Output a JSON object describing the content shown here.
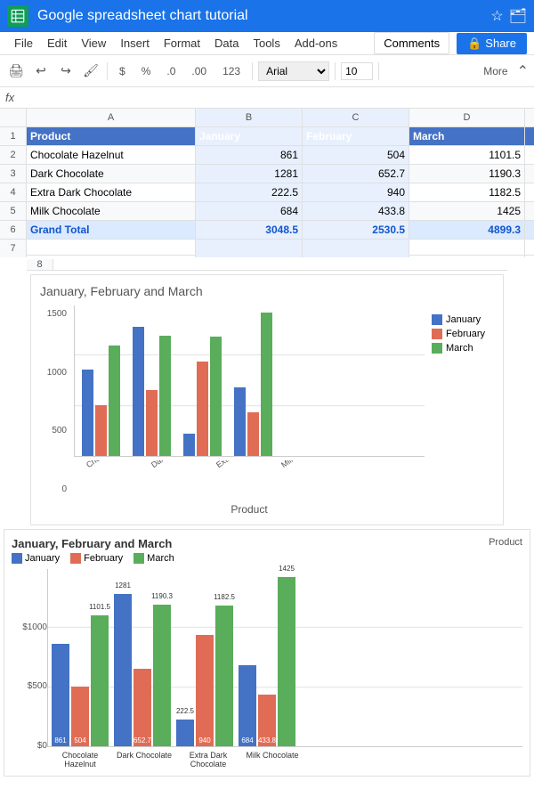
{
  "app": {
    "title": "Google spreadsheet chart tutorial",
    "icon_bg": "#0f9d58"
  },
  "menu": {
    "items": [
      "File",
      "Edit",
      "View",
      "Insert",
      "Format",
      "Data",
      "Tools",
      "Add-ons"
    ],
    "btn_comments": "Comments",
    "btn_share": "Share"
  },
  "toolbar": {
    "font": "Arial",
    "font_size": "10",
    "more_label": "More"
  },
  "spreadsheet": {
    "col_headers": [
      "",
      "A",
      "B",
      "C",
      "D"
    ],
    "row_nums": [
      "1",
      "2",
      "3",
      "4",
      "5",
      "6"
    ],
    "headers": {
      "row": 1,
      "cells": [
        "Product",
        "January",
        "February",
        "March"
      ]
    },
    "data": [
      {
        "row": 2,
        "product": "Chocolate Hazelnut",
        "jan": "861",
        "feb": "504",
        "mar": "1101.5"
      },
      {
        "row": 3,
        "product": "Dark Chocolate",
        "jan": "1281",
        "feb": "652.7",
        "mar": "1190.3"
      },
      {
        "row": 4,
        "product": "Extra Dark Chocolate",
        "jan": "222.5",
        "feb": "940",
        "mar": "1182.5"
      },
      {
        "row": 5,
        "product": "Milk Chocolate",
        "jan": "684",
        "feb": "433.8",
        "mar": "1425"
      },
      {
        "row": 6,
        "product": "Grand Total",
        "jan": "3048.5",
        "feb": "2530.5",
        "mar": "4899.3"
      }
    ]
  },
  "chart1": {
    "title": "January, February and March",
    "x_axis_label": "Product",
    "legend": [
      "January",
      "February",
      "March"
    ],
    "colors": [
      "#4472c4",
      "#e06c55",
      "#5aad5a"
    ],
    "y_ticks": [
      "1500",
      "1000",
      "500",
      "0"
    ],
    "x_labels": [
      "Chocolate Hazel...",
      "Dark Chocolate",
      "Extra Dark Choc...",
      "Milk Chocolate"
    ],
    "data": [
      {
        "jan": 861,
        "feb": 504,
        "mar": 1101.5
      },
      {
        "jan": 1281,
        "feb": 652.7,
        "mar": 1190.3
      },
      {
        "jan": 222.5,
        "feb": 940,
        "mar": 1182.5
      },
      {
        "jan": 684,
        "feb": 433.8,
        "mar": 1425
      }
    ]
  },
  "chart2": {
    "title": "January, February and March",
    "product_label": "Product",
    "legend": [
      "January",
      "February",
      "March"
    ],
    "colors": [
      "#4472c4",
      "#e06c55",
      "#5aad5a"
    ],
    "y_labels": [
      "$1000",
      "$500"
    ],
    "x_labels": [
      "Chocolate Hazelnut",
      "Dark Chocolate",
      "Extra Dark Chocolate",
      "Milk Chocolate"
    ],
    "data": [
      {
        "product": "Chocolate Hazelnut",
        "jan": 861,
        "feb": 504,
        "mar": 1101.5
      },
      {
        "product": "Dark Chocolate",
        "jan": 1281,
        "feb": 652.7,
        "mar": 1190.3
      },
      {
        "product": "Extra Dark Chocolate",
        "jan": 222.5,
        "feb": 940,
        "mar": 1182.5
      },
      {
        "product": "Milk Chocolate",
        "jan": 684,
        "feb": 433.8,
        "mar": 1425
      }
    ]
  }
}
